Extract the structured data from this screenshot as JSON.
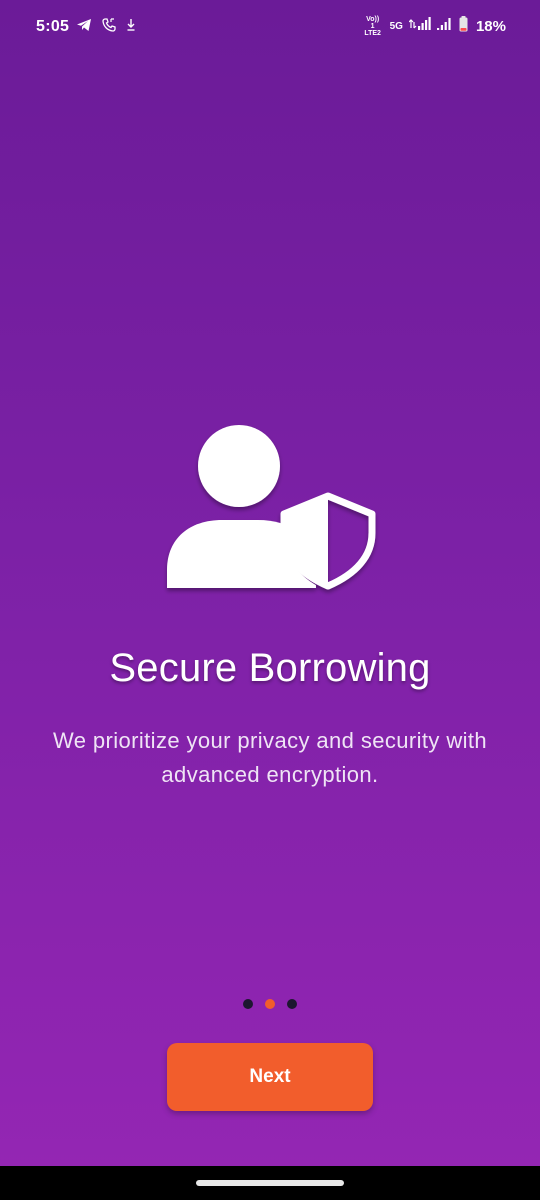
{
  "status_bar": {
    "time": "5:05",
    "volte_top": "Vo)) 1",
    "volte_bottom": "LTE2",
    "network": "5G",
    "battery": "18%",
    "icons": [
      "telegram-icon",
      "phone-call-icon",
      "download-icon",
      "signal-icon",
      "signal-icon",
      "battery-icon"
    ]
  },
  "onboarding": {
    "illustration_icon": "user-shield-icon",
    "title": "Secure Borrowing",
    "subtitle": "We prioritize your privacy and security with advanced encryption.",
    "page_indicator": {
      "total": 3,
      "active_index": 1
    },
    "next_label": "Next"
  },
  "colors": {
    "background_top": "#6b1b98",
    "background_bottom": "#9526b4",
    "accent": "#f25d2c",
    "dot_inactive": "#1d1730",
    "icon": "#ffffff"
  }
}
